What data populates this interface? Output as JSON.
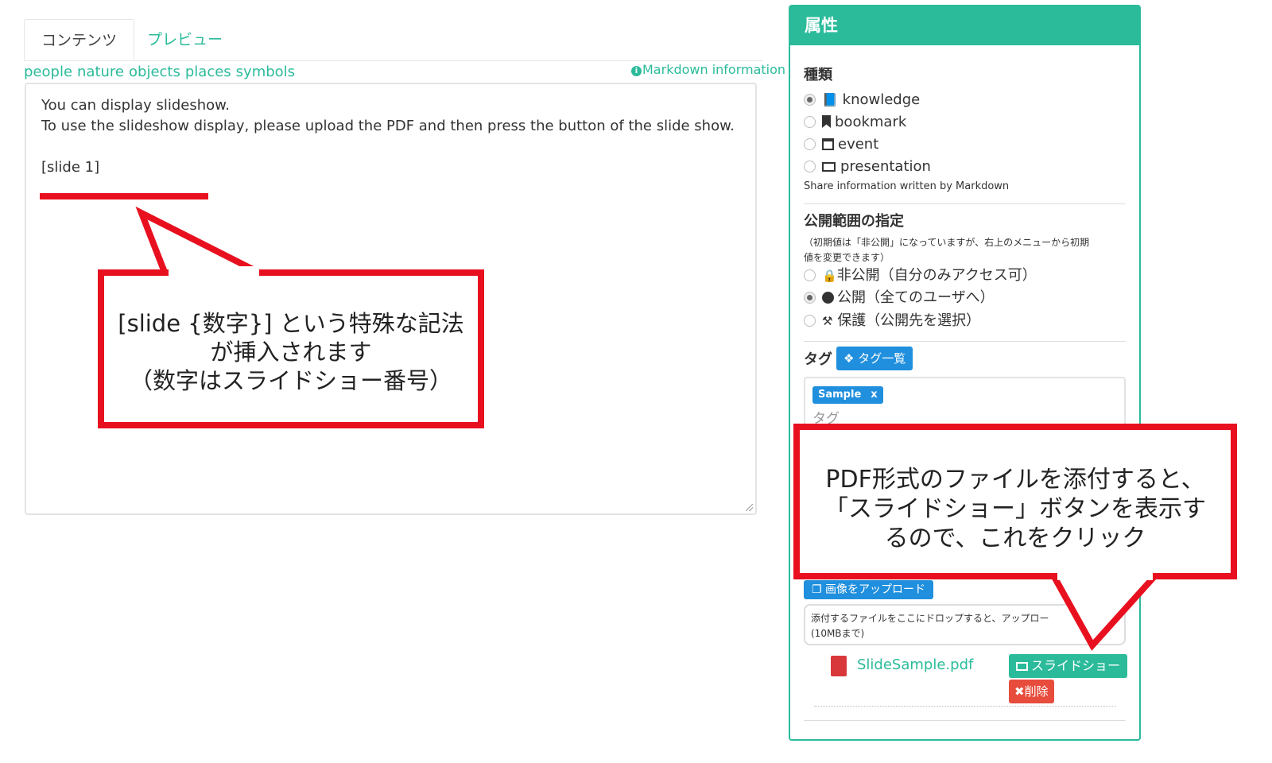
{
  "tabs": {
    "content": "コンテンツ",
    "preview": "プレビュー"
  },
  "emoji_categories": [
    "people",
    "nature",
    "objects",
    "places",
    "symbols"
  ],
  "markdown_info": "Markdown information",
  "editor": {
    "lines": [
      "You can display slideshow.",
      "To use the slideshow display, please upload the PDF and then press the button of the slide show.",
      "",
      "[slide 1]"
    ]
  },
  "callout1": {
    "lines": [
      "[slide {数字}] という特殊な記法",
      "が挿入されます",
      "（数字はスライドショー番号）"
    ]
  },
  "callout2": {
    "lines": [
      "PDF形式のファイルを添付すると、",
      "「スライドショー」ボタンを表示す",
      "るので、これをクリック"
    ]
  },
  "panel": {
    "header": "属性",
    "type_section": {
      "title": "種類",
      "options": [
        {
          "label": "knowledge",
          "icon": "book-icon",
          "checked": true
        },
        {
          "label": "bookmark",
          "icon": "bookmark-icon",
          "checked": false
        },
        {
          "label": "event",
          "icon": "calendar-icon",
          "checked": false
        },
        {
          "label": "presentation",
          "icon": "monitor-icon",
          "checked": false
        }
      ],
      "note": "Share information written by Markdown"
    },
    "visibility_section": {
      "title": "公開範囲の指定",
      "note": "（初期値は「非公開」になっていますが、右上のメニューから初期値を変更できます）",
      "note_lines": [
        "（初期値は「非公開」になっていますが、右上のメニューから初期",
        "値を変更できます）"
      ],
      "options": [
        {
          "label": "非公開（自分のみアクセス可）",
          "icon": "lock-icon",
          "checked": false
        },
        {
          "label": "公開（全てのユーザへ）",
          "icon": "globe-icon",
          "checked": true
        },
        {
          "label": "保護（公開先を選択）",
          "icon": "gavel-icon",
          "checked": false
        }
      ]
    },
    "tags_section": {
      "title": "タグ",
      "list_button": "タグ一覧",
      "chips": [
        "Sample"
      ],
      "chip_remove": "x",
      "placeholder": "タグ"
    },
    "upload_button": "画像をアップロード",
    "dropzone_lines": [
      "添付するファイルをここにドロップすると、アップロー",
      "(10MBまで)"
    ],
    "attachment": {
      "file_name": "SlideSample.pdf",
      "slideshow_button": "スライドショー",
      "delete_button": "削除"
    }
  },
  "colors": {
    "accent": "#2bbb9b",
    "primary": "#1f8fde",
    "danger": "#e74c3c",
    "annotation_red": "#e8101f"
  }
}
